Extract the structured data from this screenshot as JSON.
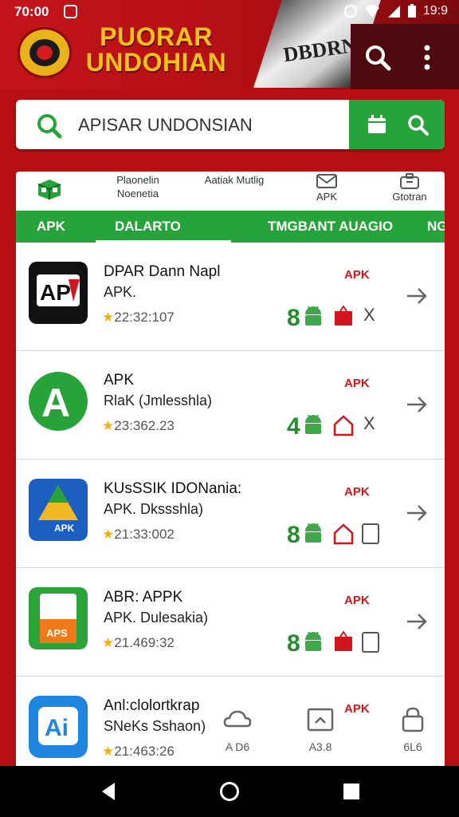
{
  "status": {
    "time": "70:00",
    "clock": "19:9"
  },
  "header": {
    "title": "PUORAR UNDOHIAN",
    "banner_text": "DBDRN"
  },
  "search": {
    "value": "APISAR UNDONSIAN"
  },
  "categories": [
    {
      "label": "Plaonelin Noenetia"
    },
    {
      "label": "Aatiak Mutlig"
    },
    {
      "label": "APK"
    },
    {
      "label": "Gtotran"
    }
  ],
  "tabs": [
    "APK",
    "DALARTO",
    "TMGBANT AUAGIO",
    "NG"
  ],
  "items": [
    {
      "title": "DPAR Dann Napl",
      "subtitle": "APK.",
      "rating": "22:32:107",
      "badge": "APK",
      "count": "8",
      "end": "X"
    },
    {
      "title": "APK",
      "subtitle": "RlaK (Jmlesshla)",
      "rating": "23:362.23",
      "badge": "APK",
      "count": "4",
      "end": "X"
    },
    {
      "title": "KUsSSIK IDONania:",
      "subtitle": "APK. Dkssshla)",
      "rating": "21:33:002",
      "badge": "APK",
      "count": "8",
      "end": ""
    },
    {
      "title": "ABR: APPK",
      "subtitle": "APK. Dulesakia)",
      "rating": "21.469:32",
      "badge": "APK",
      "count": "8",
      "end": ""
    },
    {
      "title": "Anl:clolortkrap",
      "subtitle": "SNeKs Sshaon)",
      "rating": "21:463:26",
      "badge": "APK"
    }
  ],
  "bottom_tools": [
    {
      "label": "A D6"
    },
    {
      "label": "A3.8"
    },
    {
      "label": "6L6"
    }
  ],
  "colors": {
    "red": "#b80f14",
    "green": "#26a33a",
    "gold": "#f4c21b"
  }
}
